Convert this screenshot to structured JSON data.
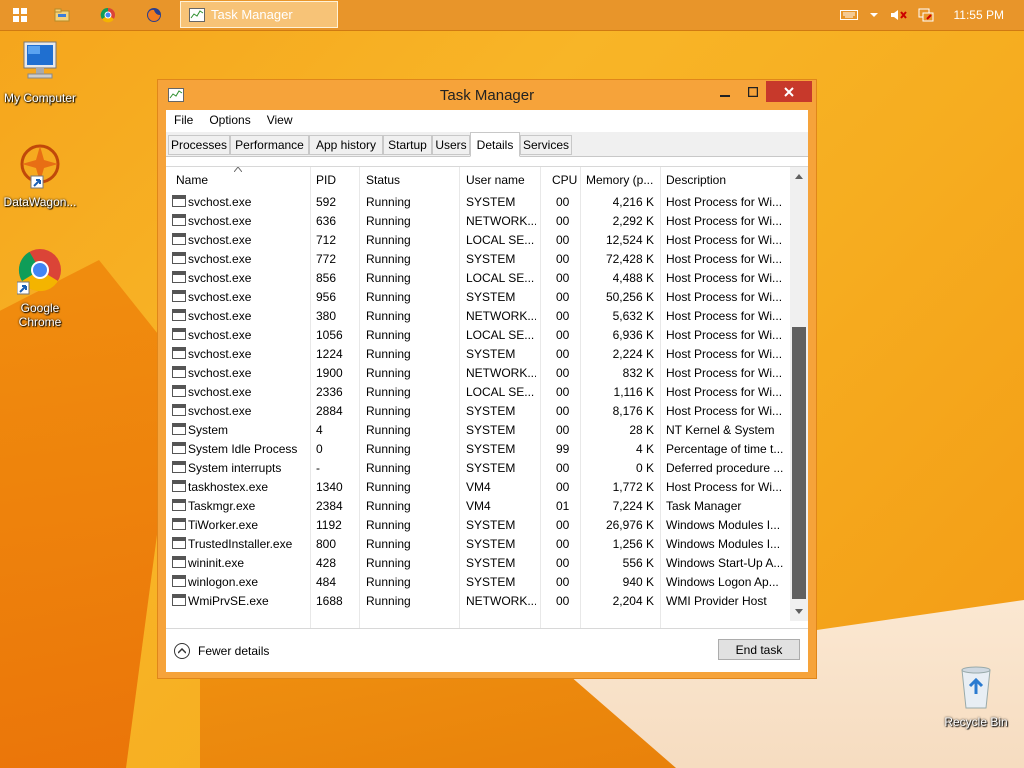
{
  "taskbar": {
    "task_label": "Task Manager",
    "clock": "11:55 PM",
    "icons": [
      "start-icon",
      "file-explorer-icon",
      "chrome-icon",
      "firefox-icon"
    ]
  },
  "desktop": {
    "icons": [
      {
        "label_lines": [
          "My Computer"
        ],
        "icon": "computer-icon"
      },
      {
        "label_lines": [
          "DataWagon..."
        ],
        "icon": "datawagon-icon"
      },
      {
        "label_lines": [
          "Google",
          "Chrome"
        ],
        "icon": "chrome-icon"
      },
      {
        "label_lines": [
          "Recycle Bin"
        ],
        "icon": "recycle-bin-icon"
      }
    ]
  },
  "window": {
    "title": "Task Manager",
    "menu": [
      "File",
      "Options",
      "View"
    ],
    "tabs": [
      "Processes",
      "Performance",
      "App history",
      "Startup",
      "Users",
      "Details",
      "Services"
    ],
    "active_tab": "Details",
    "columns": [
      "Name",
      "PID",
      "Status",
      "User name",
      "CPU",
      "Memory (p...",
      "Description"
    ],
    "rows": [
      {
        "name": "svchost.exe",
        "pid": "592",
        "status": "Running",
        "user": "SYSTEM",
        "cpu": "00",
        "mem": "4,216 K",
        "desc": "Host Process for Wi..."
      },
      {
        "name": "svchost.exe",
        "pid": "636",
        "status": "Running",
        "user": "NETWORK...",
        "cpu": "00",
        "mem": "2,292 K",
        "desc": "Host Process for Wi..."
      },
      {
        "name": "svchost.exe",
        "pid": "712",
        "status": "Running",
        "user": "LOCAL SE...",
        "cpu": "00",
        "mem": "12,524 K",
        "desc": "Host Process for Wi..."
      },
      {
        "name": "svchost.exe",
        "pid": "772",
        "status": "Running",
        "user": "SYSTEM",
        "cpu": "00",
        "mem": "72,428 K",
        "desc": "Host Process for Wi..."
      },
      {
        "name": "svchost.exe",
        "pid": "856",
        "status": "Running",
        "user": "LOCAL SE...",
        "cpu": "00",
        "mem": "4,488 K",
        "desc": "Host Process for Wi..."
      },
      {
        "name": "svchost.exe",
        "pid": "956",
        "status": "Running",
        "user": "SYSTEM",
        "cpu": "00",
        "mem": "50,256 K",
        "desc": "Host Process for Wi..."
      },
      {
        "name": "svchost.exe",
        "pid": "380",
        "status": "Running",
        "user": "NETWORK...",
        "cpu": "00",
        "mem": "5,632 K",
        "desc": "Host Process for Wi..."
      },
      {
        "name": "svchost.exe",
        "pid": "1056",
        "status": "Running",
        "user": "LOCAL SE...",
        "cpu": "00",
        "mem": "6,936 K",
        "desc": "Host Process for Wi..."
      },
      {
        "name": "svchost.exe",
        "pid": "1224",
        "status": "Running",
        "user": "SYSTEM",
        "cpu": "00",
        "mem": "2,224 K",
        "desc": "Host Process for Wi..."
      },
      {
        "name": "svchost.exe",
        "pid": "1900",
        "status": "Running",
        "user": "NETWORK...",
        "cpu": "00",
        "mem": "832 K",
        "desc": "Host Process for Wi..."
      },
      {
        "name": "svchost.exe",
        "pid": "2336",
        "status": "Running",
        "user": "LOCAL SE...",
        "cpu": "00",
        "mem": "1,116 K",
        "desc": "Host Process for Wi..."
      },
      {
        "name": "svchost.exe",
        "pid": "2884",
        "status": "Running",
        "user": "SYSTEM",
        "cpu": "00",
        "mem": "8,176 K",
        "desc": "Host Process for Wi..."
      },
      {
        "name": "System",
        "pid": "4",
        "status": "Running",
        "user": "SYSTEM",
        "cpu": "00",
        "mem": "28 K",
        "desc": "NT Kernel & System"
      },
      {
        "name": "System Idle Process",
        "pid": "0",
        "status": "Running",
        "user": "SYSTEM",
        "cpu": "99",
        "mem": "4 K",
        "desc": "Percentage of time t..."
      },
      {
        "name": "System interrupts",
        "pid": "-",
        "status": "Running",
        "user": "SYSTEM",
        "cpu": "00",
        "mem": "0 K",
        "desc": "Deferred procedure ..."
      },
      {
        "name": "taskhostex.exe",
        "pid": "1340",
        "status": "Running",
        "user": "VM4",
        "cpu": "00",
        "mem": "1,772 K",
        "desc": "Host Process for Wi..."
      },
      {
        "name": "Taskmgr.exe",
        "pid": "2384",
        "status": "Running",
        "user": "VM4",
        "cpu": "01",
        "mem": "7,224 K",
        "desc": "Task Manager"
      },
      {
        "name": "TiWorker.exe",
        "pid": "1192",
        "status": "Running",
        "user": "SYSTEM",
        "cpu": "00",
        "mem": "26,976 K",
        "desc": "Windows Modules I..."
      },
      {
        "name": "TrustedInstaller.exe",
        "pid": "800",
        "status": "Running",
        "user": "SYSTEM",
        "cpu": "00",
        "mem": "1,256 K",
        "desc": "Windows Modules I..."
      },
      {
        "name": "wininit.exe",
        "pid": "428",
        "status": "Running",
        "user": "SYSTEM",
        "cpu": "00",
        "mem": "556 K",
        "desc": "Windows Start-Up A..."
      },
      {
        "name": "winlogon.exe",
        "pid": "484",
        "status": "Running",
        "user": "SYSTEM",
        "cpu": "00",
        "mem": "940 K",
        "desc": "Windows Logon Ap..."
      },
      {
        "name": "WmiPrvSE.exe",
        "pid": "1688",
        "status": "Running",
        "user": "NETWORK...",
        "cpu": "00",
        "mem": "2,204 K",
        "desc": "WMI Provider Host"
      }
    ],
    "footer": {
      "fewer_details": "Fewer details",
      "end_task": "End task"
    }
  }
}
